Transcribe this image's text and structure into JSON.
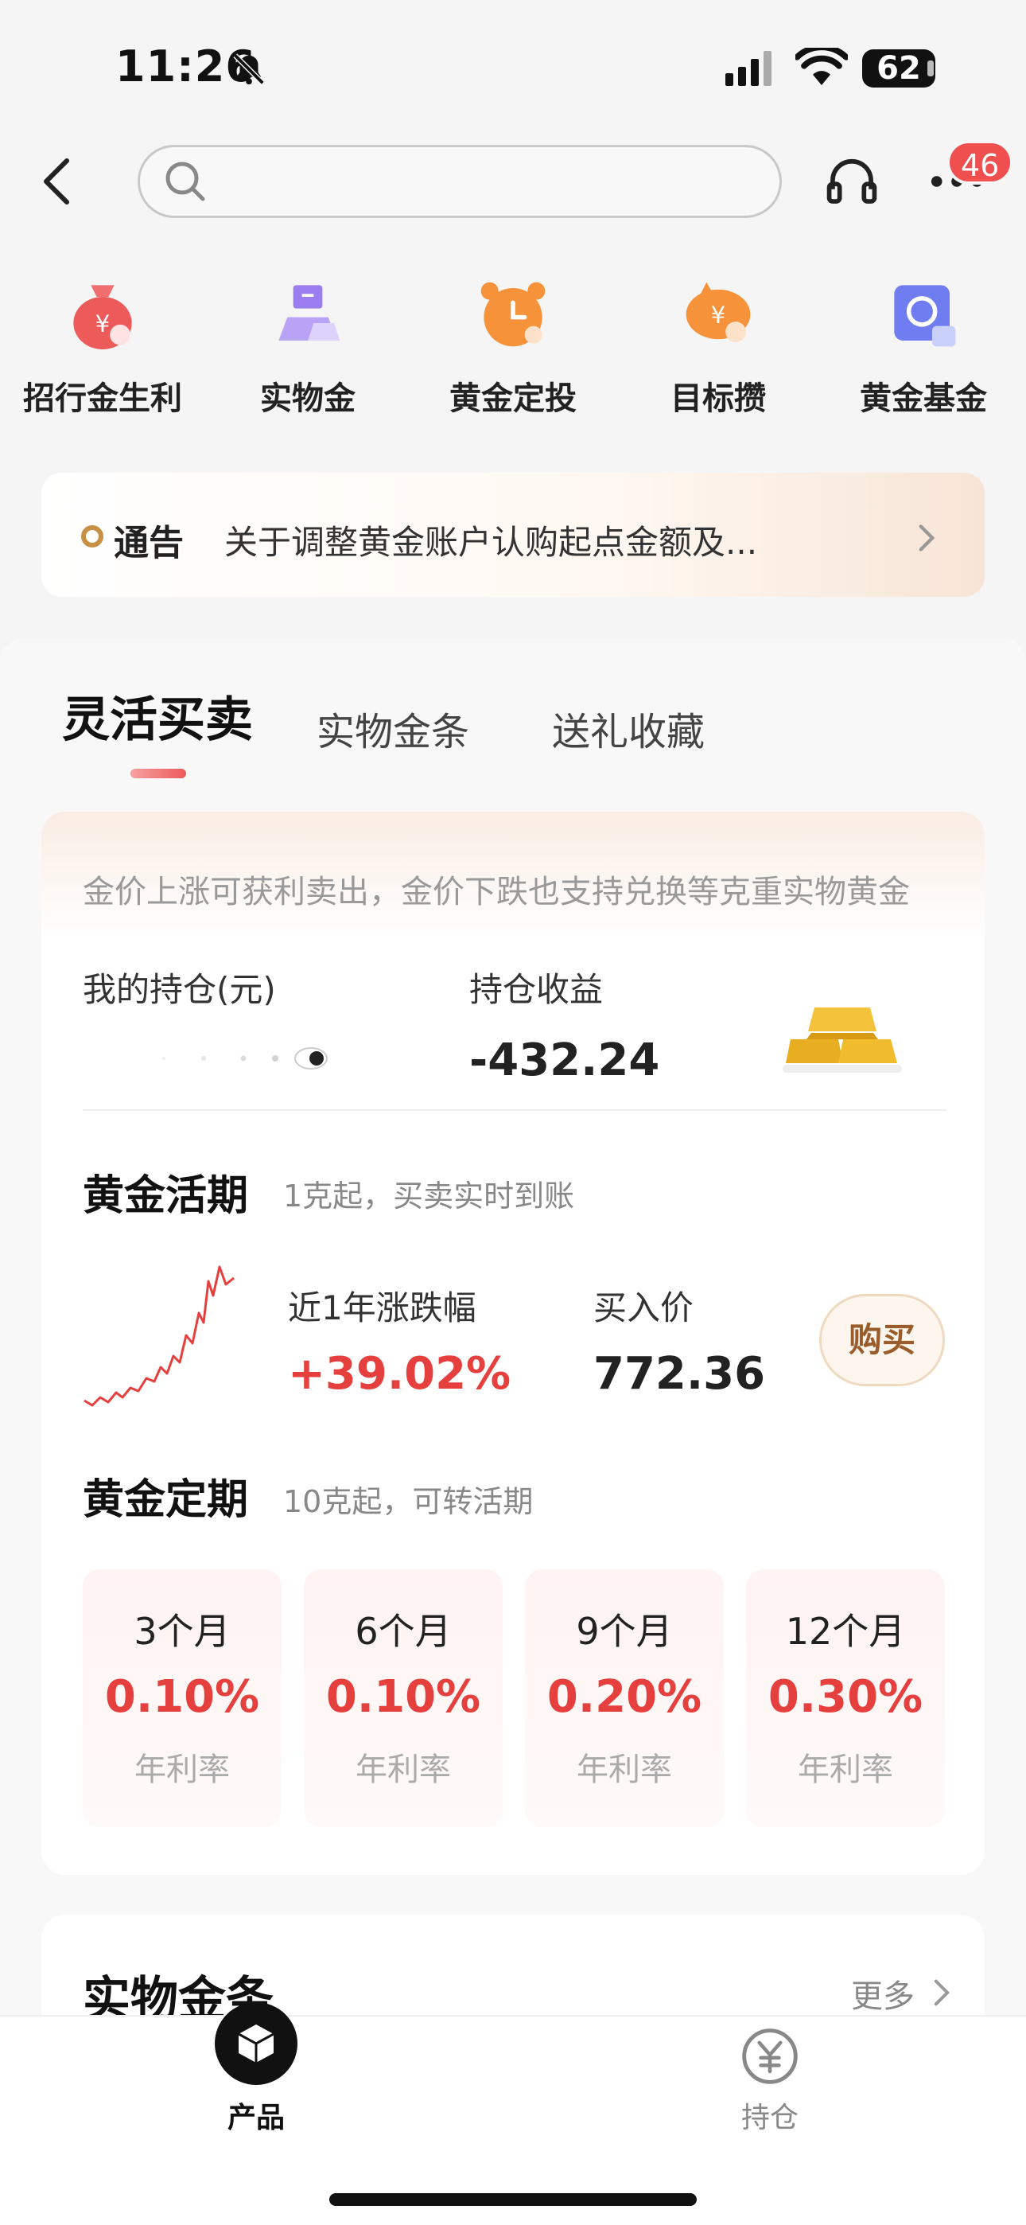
{
  "status_bar": {
    "time": "11:26",
    "battery": "62"
  },
  "header": {
    "badge_count": "46",
    "search_placeholder": ""
  },
  "quick_entries": [
    {
      "label": "招行金生利",
      "icon": "money-bag-icon"
    },
    {
      "label": "实物金",
      "icon": "gold-bar-icon"
    },
    {
      "label": "黄金定投",
      "icon": "alarm-clock-icon"
    },
    {
      "label": "目标攒",
      "icon": "piggy-bank-icon"
    },
    {
      "label": "黄金基金",
      "icon": "fund-box-icon"
    }
  ],
  "notice": {
    "tag": "通告",
    "text": "关于调整黄金账户认购起点金额及..."
  },
  "tabs": [
    {
      "label": "灵活买卖",
      "active": true
    },
    {
      "label": "实物金条",
      "active": false
    },
    {
      "label": "送礼收藏",
      "active": false
    }
  ],
  "flex_card": {
    "description": "金价上涨可获利卖出，金价下跌也支持兑换等克重实物黄金",
    "holding_label": "我的持仓(元)",
    "profit_label": "持仓收益",
    "profit_value": "-432.24"
  },
  "demand_gold": {
    "title": "黄金活期",
    "subtitle": "1克起，买卖实时到账",
    "change_label": "近1年涨跌幅",
    "change_value": "+39.02%",
    "price_label": "买入价",
    "price_value": "772.36",
    "buy_label": "购买"
  },
  "term_gold": {
    "title": "黄金定期",
    "subtitle": "10克起，可转活期",
    "terms": [
      {
        "period": "3个月",
        "rate": "0.10%",
        "rate_label": "年利率"
      },
      {
        "period": "6个月",
        "rate": "0.10%",
        "rate_label": "年利率"
      },
      {
        "period": "9个月",
        "rate": "0.20%",
        "rate_label": "年利率"
      },
      {
        "period": "12个月",
        "rate": "0.30%",
        "rate_label": "年利率"
      }
    ]
  },
  "physical_section": {
    "title": "实物金条",
    "more_label": "更多"
  },
  "bottom_nav": [
    {
      "label": "产品",
      "active": true
    },
    {
      "label": "持仓",
      "active": false
    }
  ],
  "colors": {
    "accent_red": "#e5403d",
    "badge": "#ef4f4f",
    "gold": "#c89045"
  }
}
